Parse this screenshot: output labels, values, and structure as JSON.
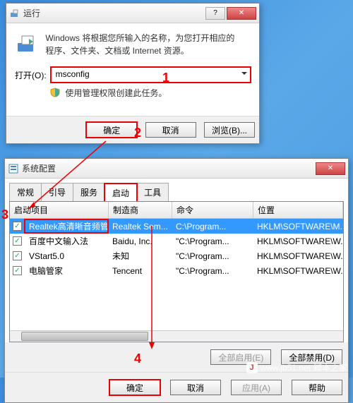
{
  "run": {
    "title": "运行",
    "description": "Windows 将根据您所输入的名称，为您打开相应的程序、文件夹、文档或 Internet 资源。",
    "open_label": "打开(O):",
    "open_value": "msconfig",
    "admin_notice": "使用管理权限创建此任务。",
    "ok": "确定",
    "cancel": "取消",
    "browse": "浏览(B)..."
  },
  "cfg": {
    "title": "系统配置",
    "tabs": [
      "常规",
      "引导",
      "服务",
      "启动",
      "工具"
    ],
    "active_tab": 3,
    "columns": [
      "启动项目",
      "制造商",
      "命令",
      "位置"
    ],
    "rows": [
      {
        "checked": true,
        "item": "Realtek高清晰音频管理器",
        "mfr": "Realtek Sem...",
        "cmd": "C:\\Program...",
        "loc": "HKLM\\SOFTWARE\\M..."
      },
      {
        "checked": true,
        "item": "百度中文输入法",
        "mfr": "Baidu, Inc.",
        "cmd": "\"C:\\Program...",
        "loc": "HKLM\\SOFTWARE\\W..."
      },
      {
        "checked": true,
        "item": "VStart5.0",
        "mfr": "未知",
        "cmd": "\"C:\\Program...",
        "loc": "HKLM\\SOFTWARE\\W..."
      },
      {
        "checked": true,
        "item": "电脑管家",
        "mfr": "Tencent",
        "cmd": "\"C:\\Program...",
        "loc": "HKLM\\SOFTWARE\\W..."
      }
    ],
    "enable_all": "全部启用(E)",
    "disable_all": "全部禁用(D)",
    "ok": "确定",
    "cancel": "取消",
    "apply": "应用(A)",
    "help": "帮助"
  },
  "watermark": {
    "site": "脚本之家",
    "url": "www.jb51.net"
  },
  "annotations": {
    "n1": "1",
    "n2": "2",
    "n3": "3",
    "n4": "4"
  }
}
